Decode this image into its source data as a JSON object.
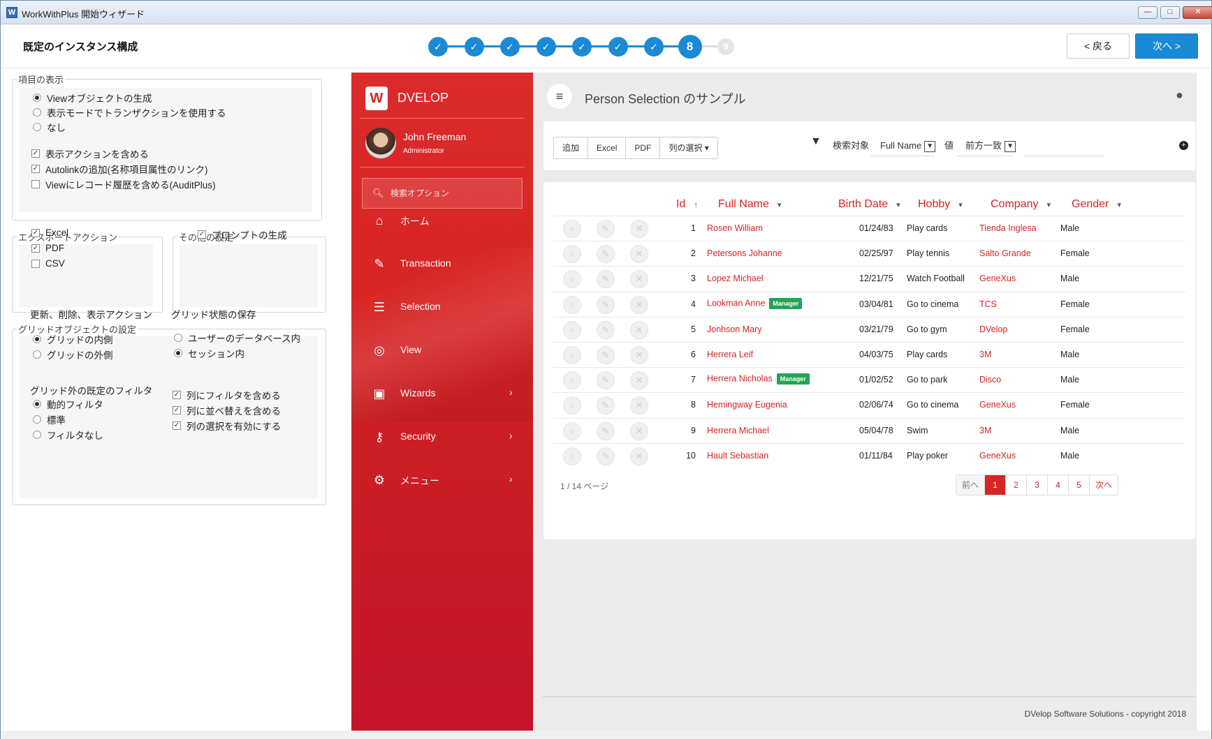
{
  "window": {
    "title": "WorkWithPlus 開始ウィザード",
    "icon": "W"
  },
  "header": {
    "title": "既定のインスタンス構成",
    "steps_done": 7,
    "current_step": "8",
    "next_step": "9",
    "back_label": "< 戻る",
    "next_label": "次へ >",
    "accent": "#1b8ad6"
  },
  "left": {
    "display": {
      "legend": "項目の表示",
      "radios": [
        "Viewオブジェクトの生成",
        "表示モードでトランザクションを使用する",
        "なし"
      ],
      "radio_selected": 0,
      "checks": [
        {
          "label": "表示アクションを含める",
          "checked": true
        },
        {
          "label": "Autolinkの追加(名称項目属性のリンク)",
          "checked": true
        },
        {
          "label": "Viewにレコード履歴を含める(AuditPlus)",
          "checked": false
        }
      ]
    },
    "export": {
      "legend": "エクスポートアクション",
      "checks": [
        {
          "label": "Excel",
          "checked": true
        },
        {
          "label": "PDF",
          "checked": true
        },
        {
          "label": "CSV",
          "checked": false
        }
      ]
    },
    "other": {
      "legend": "その他の設定",
      "checks": [
        {
          "label": "プロンプトの生成",
          "checked": true
        }
      ]
    },
    "grid": {
      "legend": "グリッドオブジェクトの設定",
      "actions_title": "更新、削除、表示アクション",
      "actions": [
        "グリッドの内側",
        "グリッドの外側"
      ],
      "state_title": "グリッド状態の保存",
      "state": [
        "ユーザーのデータベース内",
        "セッション内"
      ],
      "filter_title": "グリッド外の既定のフィルタ",
      "filters": [
        "動的フィルタ",
        "標準",
        "フィルタなし"
      ],
      "checks": [
        {
          "label": "列にフィルタを含める",
          "checked": true
        },
        {
          "label": "列に並べ替えを含める",
          "checked": true
        },
        {
          "label": "列の選択を有効にする",
          "checked": true
        }
      ]
    }
  },
  "sidebar": {
    "brand": "DVELOP",
    "logo": "W",
    "user_name": "John Freeman",
    "user_role": "Administrator",
    "search_placeholder": "検索オプション",
    "items": [
      {
        "label": "ホーム",
        "icon": "home-icon",
        "glyph": "⌂",
        "submenu": false
      },
      {
        "label": "Transaction",
        "icon": "edit-icon",
        "glyph": "✎",
        "submenu": false
      },
      {
        "label": "Selection",
        "icon": "list-icon",
        "glyph": "☰",
        "submenu": false
      },
      {
        "label": "View",
        "icon": "target-icon",
        "glyph": "◎",
        "submenu": false
      },
      {
        "label": "Wizards",
        "icon": "briefcase-icon",
        "glyph": "▣",
        "submenu": true
      },
      {
        "label": "Security",
        "icon": "key-icon",
        "glyph": "⚷",
        "submenu": true
      },
      {
        "label": "メニュー",
        "icon": "gears-icon",
        "glyph": "⚙",
        "submenu": true
      }
    ],
    "color": "#d72424"
  },
  "app": {
    "page_title": "Person Selection のサンプル",
    "toolbar": [
      "追加",
      "Excel",
      "PDF",
      "列の選択 ▾"
    ],
    "filter": {
      "search_label": "検索対象",
      "field": "Full Name",
      "value_label": "値",
      "mode": "前方一致"
    },
    "columns": [
      "Id",
      "Full Name",
      "Birth Date",
      "Hobby",
      "Company",
      "Gender"
    ],
    "rows": [
      {
        "id": "1",
        "name": "Rosen William",
        "badge": "",
        "birth": "01/24/83",
        "hobby": "Play cards",
        "company": "Tienda Inglesa",
        "gender": "Male"
      },
      {
        "id": "2",
        "name": "Petersons Johanne",
        "badge": "",
        "birth": "02/25/97",
        "hobby": "Play tennis",
        "company": "Salto Grande",
        "gender": "Female"
      },
      {
        "id": "3",
        "name": "Lopez Michael",
        "badge": "",
        "birth": "12/21/75",
        "hobby": "Watch Football",
        "company": "GeneXus",
        "gender": "Male"
      },
      {
        "id": "4",
        "name": "Lookman Anne",
        "badge": "Manager",
        "birth": "03/04/81",
        "hobby": "Go to cinema",
        "company": "TCS",
        "gender": "Female"
      },
      {
        "id": "5",
        "name": "Jonhson Mary",
        "badge": "",
        "birth": "03/21/79",
        "hobby": "Go to gym",
        "company": "DVelop",
        "gender": "Female"
      },
      {
        "id": "6",
        "name": "Herrera Leif",
        "badge": "",
        "birth": "04/03/75",
        "hobby": "Play cards",
        "company": "3M",
        "gender": "Male"
      },
      {
        "id": "7",
        "name": "Herrera Nicholas",
        "badge": "Manager",
        "birth": "01/02/52",
        "hobby": "Go to park",
        "company": "Disco",
        "gender": "Male"
      },
      {
        "id": "8",
        "name": "Hemingway Eugenia",
        "badge": "",
        "birth": "02/06/74",
        "hobby": "Go to cinema",
        "company": "GeneXus",
        "gender": "Female"
      },
      {
        "id": "9",
        "name": "Herrera Michael",
        "badge": "",
        "birth": "05/04/78",
        "hobby": "Swim",
        "company": "3M",
        "gender": "Male"
      },
      {
        "id": "10",
        "name": "Hault Sebastian",
        "badge": "",
        "birth": "01/11/84",
        "hobby": "Play poker",
        "company": "GeneXus",
        "gender": "Male"
      }
    ],
    "page_info": "1 / 14 ページ",
    "pager": {
      "prev": "前へ",
      "pages": [
        "1",
        "2",
        "3",
        "4",
        "5"
      ],
      "current": "1",
      "next": "次へ"
    },
    "copyright": "DVelop Software Solutions - copyright 2018"
  }
}
